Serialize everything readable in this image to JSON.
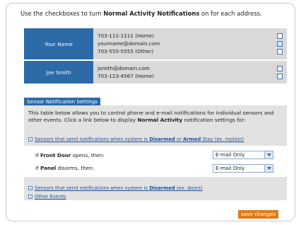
{
  "intro": {
    "pre": "Use the checkboxes to turn ",
    "bold": "Normal Activity Notifications",
    "post": " on for each address."
  },
  "contacts": [
    {
      "name": "Your Name",
      "addresses": [
        {
          "text": "703-111-1111 (Home)",
          "checked": false
        },
        {
          "text": "yourname@domain.com",
          "checked": true
        },
        {
          "text": "703-555-5555 (Other)",
          "checked": false
        }
      ]
    },
    {
      "name": "Joe Smith",
      "addresses": [
        {
          "text": "jsmith@domain.com",
          "checked": false
        },
        {
          "text": "703-123-4567 (Home)",
          "checked": false
        }
      ]
    }
  ],
  "sensor": {
    "title": "Sensor Notification Settings",
    "desc_pre": "This table below allows you to control phone and e-mail notifications for individual sensors and other events. Click a link below to display ",
    "desc_bold": "Normal Activity",
    "desc_post": " notification settings for:",
    "link1_pre": "Sensors that send notifications when system is ",
    "link1_b1": "Disarmed",
    "link1_mid": " or ",
    "link1_b2": "Armed",
    "link1_post": " Stay (ex. motion)",
    "cond1_pre": "If ",
    "cond1_bold": "Front Door",
    "cond1_post": " opens, then:",
    "cond1_value": "E-mail Only",
    "cond2_pre": "If ",
    "cond2_bold": "Panel",
    "cond2_post": " disarms, then:",
    "cond2_value": "E-mail Only",
    "link2_pre": "Sensors that send notifications when system is ",
    "link2_bold": "Disarmed",
    "link2_post": " (ex. doors)",
    "link3": "Other Events"
  },
  "save_label": "save changes"
}
